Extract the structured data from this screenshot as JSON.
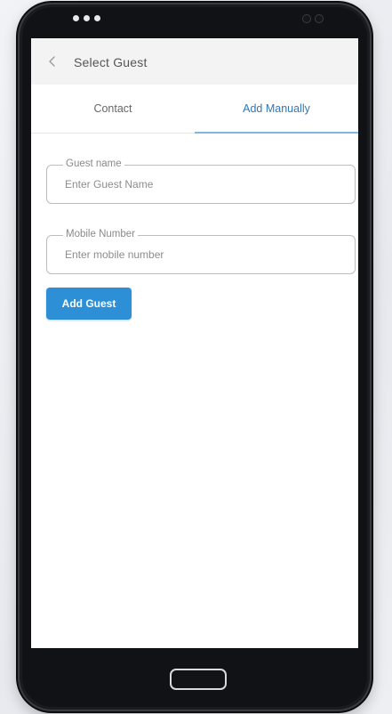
{
  "header": {
    "title": "Select Guest",
    "back_icon": "chevron-left-icon"
  },
  "tabs": [
    {
      "label": "Contact",
      "active": false
    },
    {
      "label": "Add Manually",
      "active": true
    }
  ],
  "form": {
    "guest_name": {
      "legend": "Guest name",
      "placeholder": "Enter Guest Name",
      "value": ""
    },
    "mobile_number": {
      "legend": "Mobile Number",
      "placeholder": "Enter mobile number",
      "value": ""
    },
    "submit_label": "Add Guest"
  },
  "colors": {
    "accent": "#2d8fd6",
    "active_tab_text": "#2e78b8",
    "tab_indicator": "#7fb7df",
    "header_bg": "#f3f3f3",
    "phone_body": "#1a1b1f"
  }
}
